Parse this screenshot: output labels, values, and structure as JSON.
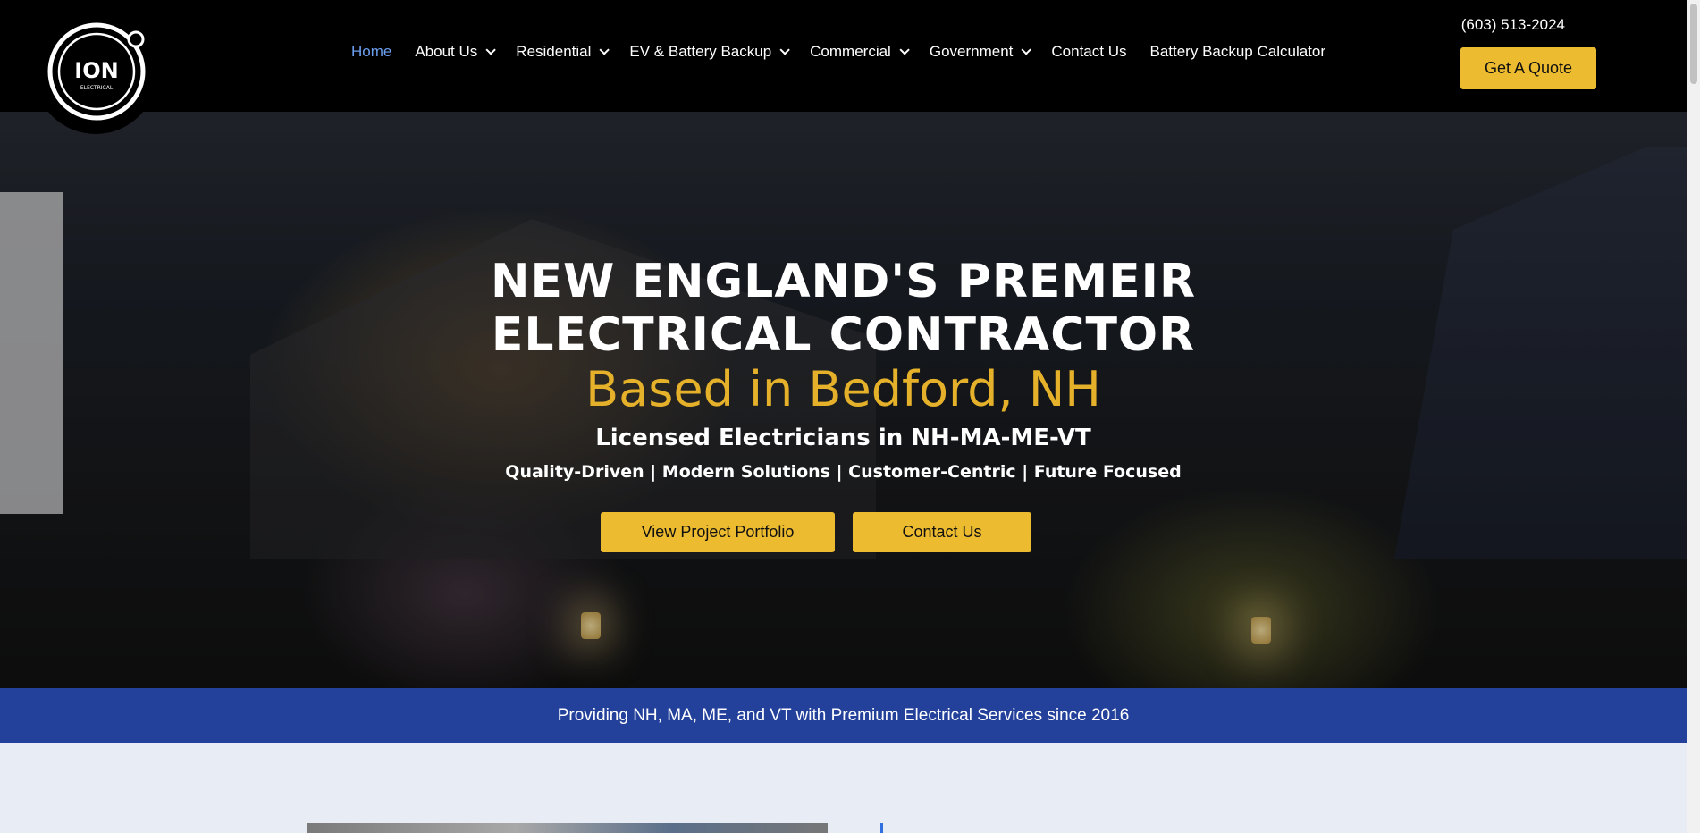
{
  "header": {
    "logo_text": "ION",
    "logo_subtext": "ELECTRICAL",
    "phone": "(603) 513-2024",
    "quote_button": "Get A Quote",
    "nav": [
      {
        "label": "Home",
        "active": true,
        "dropdown": false
      },
      {
        "label": "About Us",
        "active": false,
        "dropdown": true
      },
      {
        "label": "Residential",
        "active": false,
        "dropdown": true
      },
      {
        "label": "EV & Battery Backup",
        "active": false,
        "dropdown": true
      },
      {
        "label": "Commercial",
        "active": false,
        "dropdown": true
      },
      {
        "label": "Government",
        "active": false,
        "dropdown": true
      },
      {
        "label": "Contact Us",
        "active": false,
        "dropdown": false
      },
      {
        "label": "Battery Backup Calculator",
        "active": false,
        "dropdown": false
      }
    ]
  },
  "hero": {
    "title_line1": "NEW ENGLAND'S PREMEIR",
    "title_line2": "ELECTRICAL CONTRACTOR",
    "subtitle": "Based in Bedford, NH",
    "licensed": "Licensed Electricians in NH-MA-ME-VT",
    "tagline": "Quality-Driven |  Modern Solutions | Customer-Centric | Future Focused",
    "button_portfolio": "View Project Portfolio",
    "button_contact": "Contact Us"
  },
  "banner": {
    "text": "Providing NH, MA, ME, and VT with Premium Electrical Services since 2016"
  },
  "colors": {
    "accent_yellow": "#ecbb2f",
    "subtitle_gold": "#e5b12a",
    "banner_blue": "#23419a",
    "nav_active": "#6b9ff0",
    "header_bg": "#000000"
  }
}
